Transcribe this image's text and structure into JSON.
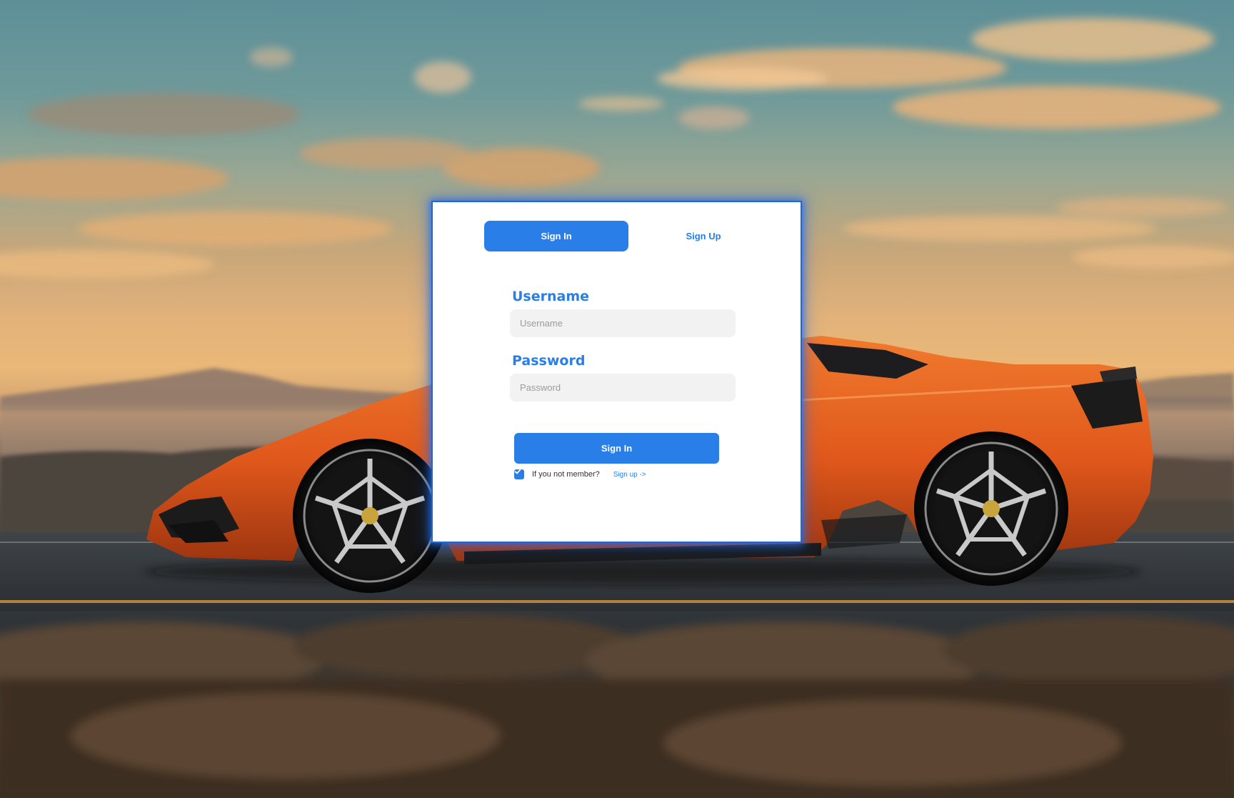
{
  "tabs": {
    "sign_in": "Sign In",
    "sign_up": "Sign Up"
  },
  "form": {
    "username_label": "Username",
    "username_placeholder": "Username",
    "username_value": "",
    "password_label": "Password",
    "password_placeholder": "Password",
    "password_value": "",
    "submit_label": "Sign In",
    "remember_checked": true,
    "member_text": "If you not member?",
    "signup_link": "Sign up ->"
  },
  "colors": {
    "accent": "#2a7ee8",
    "input_background": "#f2f2f2",
    "card_background": "#ffffff",
    "car_body": "#e0581b"
  },
  "icons": {
    "checkbox": "check-icon"
  }
}
